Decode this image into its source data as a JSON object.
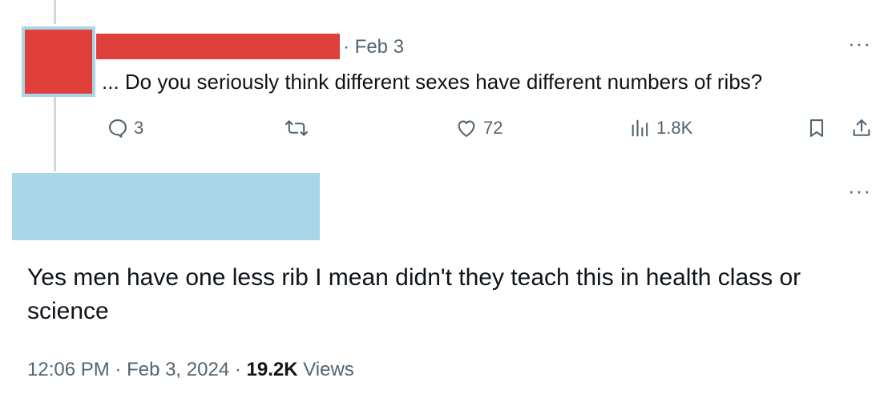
{
  "parent_tweet": {
    "date": "Feb 3",
    "text": "... Do you seriously think different sexes have different numbers of ribs?",
    "actions": {
      "replies": "3",
      "likes": "72",
      "views": "1.8K"
    }
  },
  "main_tweet": {
    "text": "Yes men have one less rib I mean didn't they teach this in health class or science",
    "time": "12:06 PM",
    "date": "Feb 3, 2024",
    "views_count": "19.2K",
    "views_label": "Views"
  },
  "colors": {
    "redaction_red": "#e0403a",
    "redaction_blue": "#a9d7e9",
    "thread_line": "#cfd9de",
    "muted_text": "#536471"
  },
  "icons": {
    "reply": "reply-icon",
    "retweet": "retweet-icon",
    "like": "heart-icon",
    "analytics": "analytics-icon",
    "bookmark": "bookmark-icon",
    "share": "share-icon",
    "more": "more-icon"
  }
}
